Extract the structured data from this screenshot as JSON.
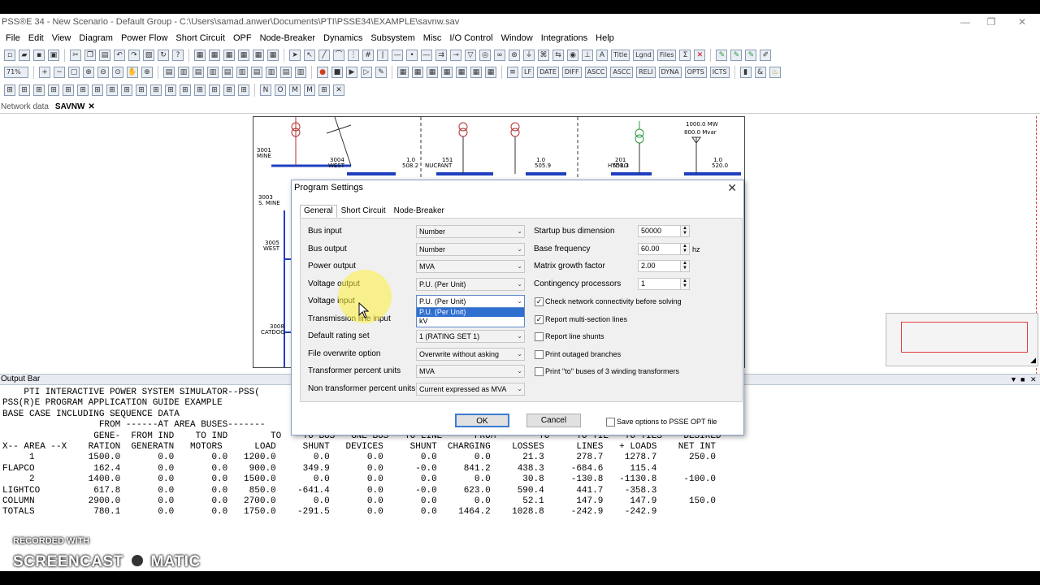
{
  "window": {
    "title": "PSS®E 34 - New Scenario - Default Group - C:\\Users\\samad.anwer\\Documents\\PTI\\PSSE34\\EXAMPLE\\savnw.sav",
    "controls": [
      "—",
      "❐",
      "✕"
    ]
  },
  "menu": [
    "File",
    "Edit",
    "View",
    "Diagram",
    "Power Flow",
    "Short Circuit",
    "OPF",
    "Node-Breaker",
    "Dynamics",
    "Subsystem",
    "Misc",
    "I/O Control",
    "Window",
    "Integrations",
    "Help"
  ],
  "toolbar": {
    "zoom": "71%",
    "text_buttons": [
      "Title",
      "Lgnd",
      "Files"
    ]
  },
  "tabs": {
    "network_data": "Network data",
    "savnw": "SAVNW",
    "close": "✕"
  },
  "diagram": {
    "labels": {
      "b3001": "3001",
      "mine": "MINE",
      "b3003": "3003",
      "smine": "S. MINE",
      "b3005": "3005",
      "west": "WEST",
      "b3008": "3008",
      "catdog": "CATDOG",
      "nucpant": "NUCPANT",
      "b151": "151",
      "hydro": "HYDRO",
      "b201": "201",
      "mw": "1000.0 MW",
      "mvar": "800.0 Mvar",
      "v1": "1.0",
      "v2": "508.2",
      "v3": "1.0",
      "v4": "505.9",
      "v5": "1.0",
      "v6": "551.3",
      "v7": "1.0",
      "v8": "520.0",
      "w3004": "3004",
      "westtop": "WEST"
    }
  },
  "output_bar": {
    "title": "Output Bar",
    "lines": [
      "    PTI INTERACTIVE POWER SYSTEM SIMULATOR--PSS(",
      "PSS(R)E PROGRAM APPLICATION GUIDE EXAMPLE",
      "BASE CASE INCLUDING SEQUENCE DATA",
      "                  FROM ------AT AREA BUSES-------",
      "                 GENE-  FROM IND    TO IND        TO    TO BUS   GNE BUS   TO LINE      FROM        TO     TO TIE   TO TIES    DESIRED",
      "X-- AREA --X    RATION  GENERATN   MOTORS      LOAD     SHUNT   DEVICES     SHUNT  CHARGING    LOSSES      LINES   + LOADS    NET INT",
      "",
      "     1          1500.0       0.0       0.0   1200.0       0.0       0.0       0.0       0.0      21.3      278.7    1278.7      250.0",
      "FLAPCO           162.4       0.0       0.0    900.0     349.9       0.0      -0.0     841.2     438.3     -684.6     115.4",
      "",
      "     2          1400.0       0.0       0.0   1500.0       0.0       0.0       0.0       0.0      30.8     -130.8   -1130.8     -100.0",
      "LIGHTCO          617.8       0.0       0.0    850.0    -641.4       0.0      -0.0     623.0     590.4      441.7    -358.3",
      "",
      "COLUMN          2900.0       0.0       0.0   2700.0       0.0       0.0       0.0       0.0      52.1      147.9     147.9      150.0",
      "TOTALS           780.1       0.0       0.0   1750.0    -291.5       0.0       0.0    1464.2    1028.8     -242.9    -242.9"
    ]
  },
  "watermark": {
    "recorded": "RECORDED WITH",
    "brand_left": "SCREENCAST",
    "brand_right": "MATIC"
  },
  "dialog": {
    "title": "Program Settings",
    "tabs": [
      "General",
      "Short Circuit",
      "Node-Breaker"
    ],
    "left_rows": [
      {
        "label": "Bus input",
        "value": "Number"
      },
      {
        "label": "Bus output",
        "value": "Number"
      },
      {
        "label": "Power output",
        "value": "MVA"
      },
      {
        "label": "Voltage output",
        "value": "P.U. (Per Unit)"
      },
      {
        "label": "Voltage input",
        "value": "P.U. (Per Unit)"
      },
      {
        "label": "Transmission line input",
        "value": ""
      },
      {
        "label": "Default rating set",
        "value": "1 (RATING SET 1)"
      },
      {
        "label": "File overwrite option",
        "value": "Overwrite without asking"
      },
      {
        "label": "Transformer percent units",
        "value": "MVA"
      },
      {
        "label": "Non transformer percent units",
        "value": "Current expressed as MVA"
      }
    ],
    "dropdown_options": [
      "P.U. (Per Unit)",
      "kV"
    ],
    "right_rows": [
      {
        "label": "Startup bus dimension",
        "value": "50000",
        "unit": ""
      },
      {
        "label": "Base frequency",
        "value": "60.00",
        "unit": "hz"
      },
      {
        "label": "Matrix growth factor",
        "value": "2.00",
        "unit": ""
      },
      {
        "label": "Contingency processors",
        "value": "1",
        "unit": ""
      }
    ],
    "checkboxes": [
      {
        "label": "Check network connectivity before solving",
        "checked": true
      },
      {
        "label": "Report multi-section lines",
        "checked": true
      },
      {
        "label": "Report line shunts",
        "checked": false
      },
      {
        "label": "Print outaged branches",
        "checked": false
      },
      {
        "label": "Print \"to\" buses of 3 winding transformers",
        "checked": false
      }
    ],
    "ok": "OK",
    "cancel": "Cancel",
    "save_option": "Save options to PSSE OPT file"
  },
  "colors": {
    "accent": "#2f6fd0",
    "bus": "#1f3fbf",
    "gen": "#2a9a3a",
    "xfmr": "#b03030"
  }
}
